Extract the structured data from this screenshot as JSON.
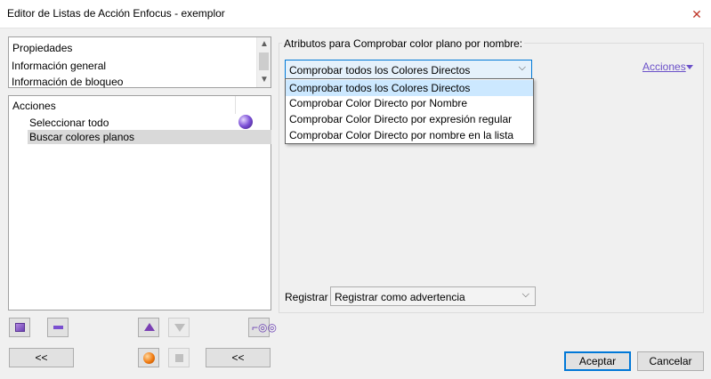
{
  "window": {
    "title": "Editor de Listas de Acción Enfocus - exemplor"
  },
  "properties_list": {
    "items": [
      {
        "label": "Propiedades"
      },
      {
        "label": "Información general"
      },
      {
        "label": "Información de bloqueo"
      }
    ]
  },
  "actions_list": {
    "header": "Acciones",
    "items": [
      {
        "label": "Seleccionar todo"
      },
      {
        "label": "Buscar colores planos"
      }
    ]
  },
  "attributes": {
    "group_label": "Atributos para Comprobar color plano por nombre:",
    "combo_value": "Comprobar todos los Colores Directos",
    "options": [
      "Comprobar todos los Colores Directos",
      "Comprobar Color Directo por Nombre",
      "Comprobar Color Directo por expresión regular",
      "Comprobar Color Directo por nombre en la lista"
    ],
    "actions_link": "Acciones"
  },
  "register": {
    "label": "Registrar",
    "value": "Registrar como advertencia"
  },
  "buttons": {
    "collapse_left": "<<",
    "collapse_right": "<<",
    "accept": "Aceptar",
    "cancel": "Cancelar"
  },
  "colors": {
    "accent": "#0078d7",
    "selection": "#cce8ff",
    "link": "#6b51c9",
    "item_highlight": "#d9d9d9"
  }
}
